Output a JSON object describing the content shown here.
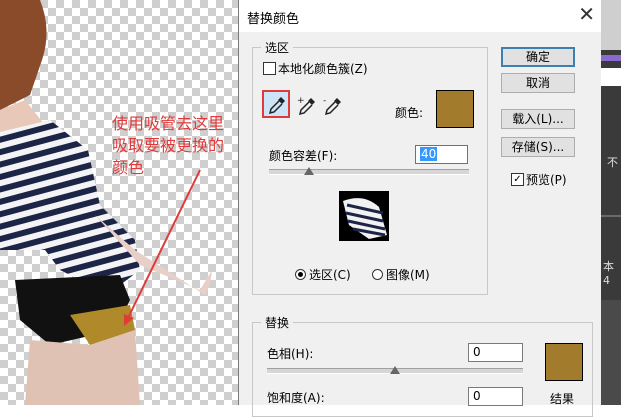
{
  "annotation": {
    "lines": [
      "使用吸管去这里",
      "吸取要被更换的",
      "颜色"
    ],
    "color": "#e03a3a"
  },
  "dialog": {
    "title": "替换颜色",
    "selection_group": {
      "legend": "选区",
      "localized_clusters_label": "本地化颜色簇(Z)",
      "localized_clusters_checked": false,
      "color_label": "颜色:",
      "color_swatch": "#a27c2c",
      "fuzziness_label": "颜色容差(F):",
      "fuzziness_value": "40",
      "fuzziness_fraction": 0.2,
      "radio_selection": "选区(C)",
      "radio_image": "图像(M)",
      "selected_radio": "selection",
      "eyedroppers": [
        "eyedropper-icon",
        "eyedropper-plus-icon",
        "eyedropper-minus-icon"
      ]
    },
    "buttons": {
      "ok": "确定",
      "cancel": "取消",
      "load": "载入(L)...",
      "save": "存储(S)..."
    },
    "preview": {
      "label": "预览(P)",
      "checked": true
    },
    "replace_group": {
      "legend": "替换",
      "hue_label": "色相(H):",
      "hue_value": "0",
      "saturation_label": "饱和度(A):",
      "saturation_value": "0",
      "result_label": "结果",
      "result_swatch": "#a27c2c"
    }
  },
  "right_strip": {
    "text_1": "不",
    "text_2": "本 4"
  }
}
